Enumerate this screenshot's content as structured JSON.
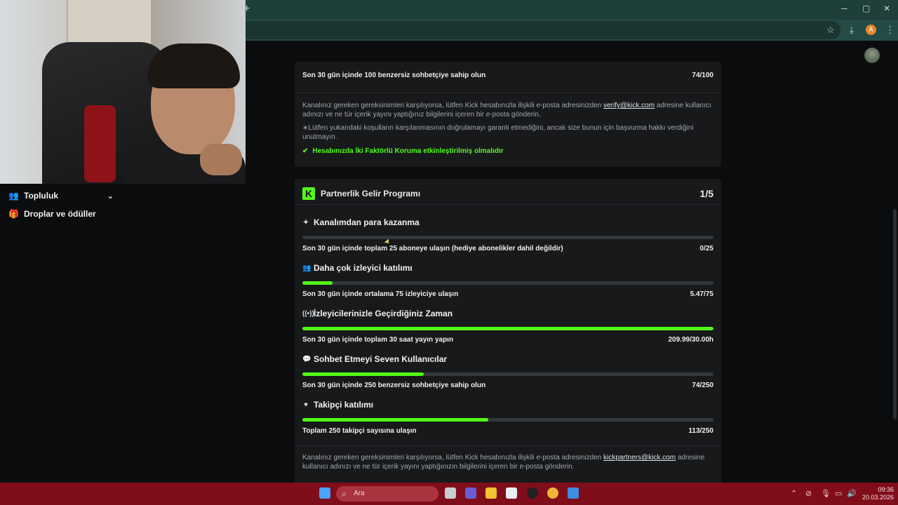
{
  "browser": {
    "new_tab": "+",
    "minimize": "─",
    "maximize": "▢",
    "close": "✕",
    "star": "☆",
    "download": "⤓",
    "profile_initial": "A",
    "menu": "⋮"
  },
  "sidebar": {
    "items": [
      {
        "label": "Topluluk",
        "icon": "community-icon",
        "glyph": "👥",
        "chevron": "⌄"
      },
      {
        "label": "Droplar ve ödüller",
        "icon": "gift-icon",
        "glyph": "🎁"
      }
    ]
  },
  "prev_card": {
    "top_row": {
      "text": "Son 30 gün içinde 100 benzersiz sohbetçiye sahip olun",
      "value": "74/100"
    },
    "notice_before": "Kanalınız gereken gereksinimleri karşılıyorsa, lütfen Kick hesabınızla ilişkili e-posta adresinizden ",
    "notice_link": "verify@kick.com",
    "notice_after": " adresine kullanıcı adınızı ve ne tür içerik yayını yaptığınız bilgilerini içeren bir e-posta gönderin.",
    "disclaimer": "∗Lütfen yukarıdaki koşulların karşılanmasının doğrulamayı garanti etmediğini, ancak size bunun için başvurma hakkı verdiğini unutmayın.",
    "two_factor": "Hesabınızda İki Faktörlü Koruma etkinleştirilmiş olmalıdır"
  },
  "partner_card": {
    "logo": "K",
    "title": "Partnerlik Gelir Programı",
    "score": "1/5",
    "sections": [
      {
        "title": "Kanalımdan para kazanma",
        "icon": "sparkle-icon",
        "glyph": "✦",
        "desc": "Son 30 gün içinde toplam 25 aboneye ulaşın (hediye abonelikler dahil değildir)",
        "value": "0/25",
        "progress": 0
      },
      {
        "title": "Daha çok izleyici katılımı",
        "icon": "viewers-icon",
        "glyph": "👥",
        "desc": "Son 30 gün içinde ortalama 75 izleyiciye ulaşın",
        "value": "5.47/75",
        "progress": 0.073
      },
      {
        "title": "İzleyicilerinizle Geçirdiğiniz Zaman",
        "icon": "broadcast-icon",
        "glyph": "((•))",
        "desc": "Son 30 gün içinde toplam 30 saat yayın yapın",
        "value": "209.99/30.00h",
        "progress": 1.0
      },
      {
        "title": "Sohbet Etmeyi Seven Kullanıcılar",
        "icon": "chat-icon",
        "glyph": "💬",
        "desc": "Son 30 gün içinde 250 benzersiz sohbetçiye sahip olun",
        "value": "74/250",
        "progress": 0.296
      },
      {
        "title": "Takipçi katılımı",
        "icon": "heart-icon",
        "glyph": "♥",
        "desc": "Toplam 250 takipçi sayısına ulaşın",
        "value": "113/250",
        "progress": 0.452
      }
    ],
    "notice_before": "Kanalınız gereken gereksinimleri karşılıyorsa, lütfen Kick hesabınızla ilişkili e-posta adresinizden ",
    "notice_link": "kickpartners@kick.com",
    "notice_after": " adresine kullanıcı adınızı ve ne tür içerik yayını yaptığınızın bilgilerini içeren bir e-posta gönderin."
  },
  "taskbar": {
    "search_placeholder": "Ara",
    "search_glyph": "⌕",
    "time": "09:36",
    "date": "20.03.2026"
  },
  "colors": {
    "accent": "#53fc18",
    "taskbar": "#800d1a",
    "card": "#18191b"
  }
}
